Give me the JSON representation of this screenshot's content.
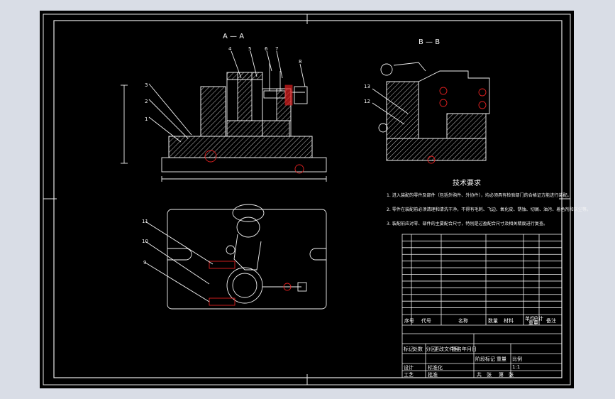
{
  "colors": {
    "background": "#d9dde6",
    "sheet": "#000000",
    "line": "#f2f2f2",
    "hatch": "#e6e6e6",
    "bolt": "#e02020"
  },
  "section_a": {
    "title": "A — A"
  },
  "section_b": {
    "title": "B — B"
  },
  "part_numbers": {
    "front": [
      "1",
      "2",
      "3",
      "4",
      "5",
      "6",
      "7",
      "8"
    ],
    "side": [
      "13",
      "12"
    ],
    "plan": [
      "11",
      "10",
      "9"
    ]
  },
  "technical_requirements": {
    "heading": "技术要求",
    "items": [
      "1. 进入装配的零件及部件（包括外购件、外协件），均必须具有检验部门的合格证方能进行装配。",
      "2. 零件在装配前必须清理和清洗干净，不得有毛刺、飞边、氧化皮、锈蚀、切屑、油污、着色剂和灰尘等。",
      "3. 装配前应对零、部件的主要配合尺寸，特别是过盈配合尺寸及相关精度进行复查。"
    ]
  },
  "title_block": {
    "col_seq": "序号",
    "col_code": "代号",
    "col_name": "名称",
    "col_qty": "数量",
    "col_material": "材料",
    "col_weight": "单件",
    "col_total": "总计",
    "col_weight_label": "重量",
    "col_remark": "备注",
    "mark_row": [
      "标记",
      "处数",
      "分区",
      "更改文件号",
      "签名",
      "年月日"
    ],
    "design": "设计",
    "process": "工艺",
    "std": "标准化",
    "approve": "批准",
    "stage": "阶段标记",
    "weight": "重量",
    "scale": "比例",
    "scale_value": "1:1",
    "sheet_total": "共　张",
    "sheet_no": "第　张"
  },
  "parts_list_rows": 12
}
